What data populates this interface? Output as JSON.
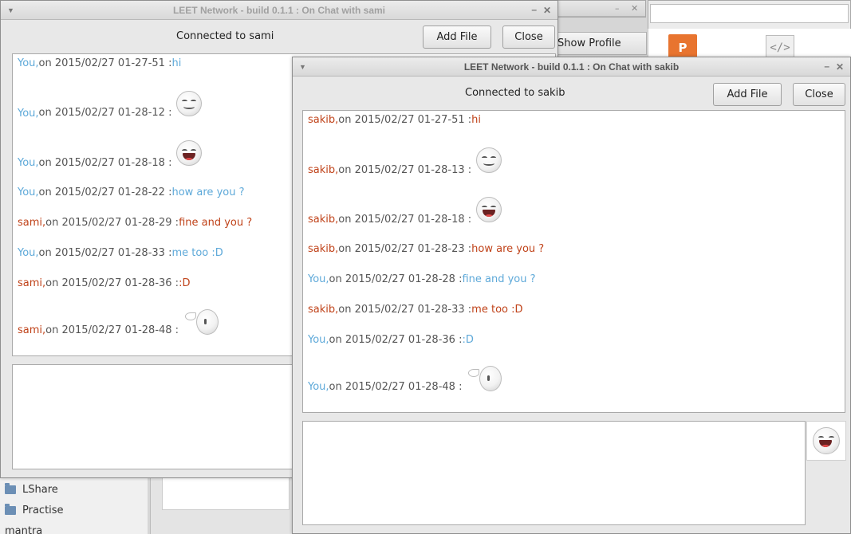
{
  "background": {
    "show_profile_label": "Show Profile",
    "tree_items": [
      "LShare",
      "Practise",
      "mantra"
    ],
    "ppt_icon_letter": "P",
    "code_icon_glyph": "</>"
  },
  "window_sami": {
    "title": "LEET Network - build 0.1.1 : On Chat with sami",
    "connected_label": "Connected to sami",
    "add_file_label": "Add File",
    "close_label": "Close",
    "messages": [
      {
        "sender": "You,",
        "meta": " on 2015/02/27 01-27-51 : ",
        "text": "hi",
        "emoticon": ""
      },
      {
        "sender": "You,",
        "meta": " on 2015/02/27 01-28-12 : ",
        "text": "",
        "emoticon": "smile-icon"
      },
      {
        "sender": "You,",
        "meta": " on 2015/02/27 01-28-18 : ",
        "text": "",
        "emoticon": "laugh-icon"
      },
      {
        "sender": "You,",
        "meta": " on 2015/02/27 01-28-22 : ",
        "text": "how are you ?",
        "emoticon": ""
      },
      {
        "sender": "sami,",
        "meta": " on 2015/02/27 01-28-29 : ",
        "text": "fine and you ?",
        "emoticon": ""
      },
      {
        "sender": "You,",
        "meta": " on 2015/02/27 01-28-33 : ",
        "text": "me too :D",
        "emoticon": ""
      },
      {
        "sender": "sami,",
        "meta": " on 2015/02/27 01-28-36 : ",
        "text": ":D",
        "emoticon": ""
      },
      {
        "sender": "sami,",
        "meta": " on 2015/02/27 01-28-48 : ",
        "text": "",
        "emoticon": "angel-icon"
      }
    ]
  },
  "window_sakib": {
    "title": "LEET Network - build 0.1.1 : On Chat with sakib",
    "connected_label": "Connected to sakib",
    "add_file_label": "Add File",
    "close_label": "Close",
    "messages": [
      {
        "sender": "sakib,",
        "meta": " on 2015/02/27 01-27-51 : ",
        "text": "hi",
        "emoticon": ""
      },
      {
        "sender": "sakib,",
        "meta": " on 2015/02/27 01-28-13 : ",
        "text": "",
        "emoticon": "smile-icon"
      },
      {
        "sender": "sakib,",
        "meta": " on 2015/02/27 01-28-18 : ",
        "text": "",
        "emoticon": "laugh-icon"
      },
      {
        "sender": "sakib,",
        "meta": " on 2015/02/27 01-28-23 : ",
        "text": "how are you ?",
        "emoticon": ""
      },
      {
        "sender": "You,",
        "meta": " on 2015/02/27 01-28-28 : ",
        "text": "fine and you ?",
        "emoticon": ""
      },
      {
        "sender": "sakib,",
        "meta": " on 2015/02/27 01-28-33 : ",
        "text": "me too :D",
        "emoticon": ""
      },
      {
        "sender": "You,",
        "meta": " on 2015/02/27 01-28-36 : ",
        "text": ":D",
        "emoticon": ""
      },
      {
        "sender": "You,",
        "meta": " on 2015/02/27 01-28-48 : ",
        "text": "",
        "emoticon": "angel-icon"
      }
    ],
    "emoji_picker_icon": "laugh-icon"
  },
  "colors": {
    "self": "#5ea9d9",
    "other": "#c0431a"
  }
}
